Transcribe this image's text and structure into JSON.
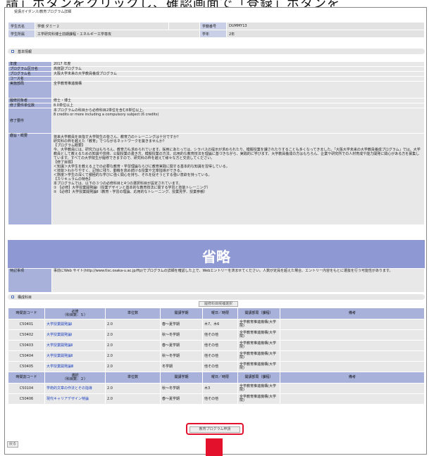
{
  "banner": "請」ボタンをクリックし、確認画面で「登録」ボタンを",
  "breadcrumb": "受講ガイダンス/教育プログラム詳細",
  "student": {
    "name_label": "学生氏名",
    "name_value": "学環 ダミー２",
    "id_label": "学籍番号",
    "id_value": "DUMMY13",
    "affil_label": "学生所属",
    "affil_value": "工学研究科博士前期課程・エネルギー工学専攻",
    "year_label": "学年",
    "year_value": "2年"
  },
  "basic_section": "基本情報",
  "info": {
    "nendo_k": "年度",
    "nendo_v": "2017 年度",
    "kubun_k": "プログラム区分名",
    "kubun_v": "高度副プログラム",
    "name_k": "プログラム名",
    "name_v": "大阪大学未来の大学教員養成プログラム",
    "course_k": "コース名",
    "course_v": "",
    "dept_k": "実施部局",
    "dept_v": "全学教育推進機構",
    "target_k": "履修対象者",
    "target_v": "修士・博士",
    "units_k": "修了要件単位数",
    "units_v": "8.0単位以上",
    "req_k": "修了要件",
    "req_v1": "本プログラムの科目から必修科目2単位を含む8単位以上。",
    "req_v2": "8 credits or more including a compulsory subject (6 credits)",
    "goal_k": "趣旨・概要",
    "goal_v1": "将来大学教員を目指す大学院生の皆さん、教育力のトレーニングは十分ですか？",
    "goal_v2": "研究科の枠を越えた「教育」でつながるネットワークを築きませんか？",
    "goal_v3": "【プログラム概要】",
    "goal_v4": "今、大学教員には、研究力はもちろん、教育力も求められています。採用にあたっては、シラバスの提示が求められたり、模擬授業を課されたりすることも多くなってきました。「大阪大学未来の大学教員養成プログラム」では、大学教員として教えるための知識や技術、公開授業の書き方、模擬授業の方法、応用的な教育技法を理論に基づきながら、実践的に学びます。大学教員養成の方はもちろん、企業や研究所での人材育成や能力開発に関心がある方を募集しています。すべての大学院生が履修できますので、研究科の枠を越えて様々な方と交流してください。",
    "goal_v5": "【修了目標】",
    "goal_v6": "＜知識＞大学生を教える上での必要な教育・学習理論ならびに教育実践に関する基本的な知識を習得している。",
    "goal_v7": "＜技能＞わかりやすく、記憶に残り、動機を高め続ける授業や文章指導ができる。",
    "goal_v8": "＜態度＞学生の深くて積極的な学びに強く関心を持ち、それを促そうとする強い意欲を持っている。",
    "goal_v9": "【カリキュラムの特色】",
    "goal_v10": "本プログラムでは、以下の３つの必修科目と4つの選択科目が設定されています。",
    "goal_v11": "① 【必修】大学授業開発論Ⅰ（授業デザインと基本的な教育技法に関する学習と技能トレーニング）",
    "goal_v12": "② 【必修】大学授業開発論Ⅱ（教育・学習の理論、応用的なトレーニング、授業見学、授業参観）",
    "omitted": "省略",
    "notes_k": "特記事項",
    "notes_v": "事前にWeb サイト(http://www.tlsc.osaka-u.ac.jp/ffp)でプログラムの詳細を確認した上で、Webエントリーを済ませてください。人数が定員を超えた場合、エントリー内容をもとに選抜を行う可能性があります。"
  },
  "select_button": "履修科目候補選択",
  "courses_section": "構成科目",
  "courses": {
    "h_code": "時間割コード",
    "h_req": "必修",
    "h_req_units": "（科目数：５）",
    "h_elec": "選択",
    "h_elec_units": "（科目数：２）",
    "h_units": "単位数",
    "h_term": "開講学期",
    "h_day": "曜日／時限",
    "h_dept": "開講部局（課程）",
    "h_note": "備考",
    "required": [
      {
        "code": "C50401",
        "name": "大学授業開発論Ⅰ",
        "units": "2.0",
        "term": "春～夏学期",
        "day": "木7、木6",
        "dept": "全学教育推進機構(大学院)"
      },
      {
        "code": "C50402",
        "name": "大学授業開発論Ⅰ",
        "units": "2.0",
        "term": "秋～冬学期",
        "day": "他その他",
        "dept": "全学教育推進機構(大学院)"
      },
      {
        "code": "C50403",
        "name": "大学授業開発論Ⅱ",
        "units": "2.0",
        "term": "春～夏学期",
        "day": "他その他",
        "dept": "全学教育推進機構(大学院)"
      },
      {
        "code": "C50404",
        "name": "大学授業開発論Ⅱ",
        "units": "2.0",
        "term": "秋～冬学期",
        "day": "他その他",
        "dept": "全学教育推進機構(大学院)"
      },
      {
        "code": "C50405",
        "name": "大学授業開発論Ⅲ",
        "units": "2.0",
        "term": "冬学期",
        "day": "他その他",
        "dept": "全学教育推進機構(大学院)"
      }
    ],
    "elective": [
      {
        "code": "C50104",
        "name": "学術的文章の作法とその指導",
        "units": "2.0",
        "term": "秋～冬学期",
        "day": "木3",
        "dept": "全学教育推進機構(大学院)"
      },
      {
        "code": "C50406",
        "name": "現代キャリアデザイン特論",
        "units": "2.0",
        "term": "春～夏学期",
        "day": "他その他",
        "dept": "全学教育推進機構(大学院)"
      }
    ]
  },
  "apply_button": "教育プログラム申請",
  "back_button": "戻る",
  "colors": {
    "highlight": "#e3112c",
    "omitted_band": "#8e99d3",
    "header": "#a7b1d9"
  }
}
